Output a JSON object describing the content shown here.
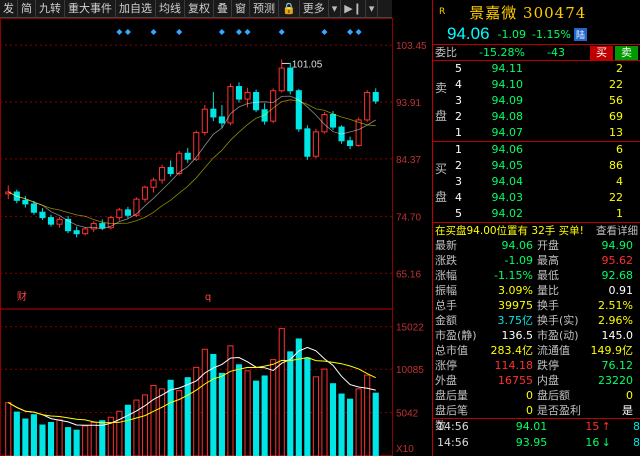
{
  "toolbar": {
    "items": [
      "发",
      "简",
      "九转",
      "重大事件",
      "加自选",
      "均线",
      "复权",
      "叠",
      "窗",
      "预测",
      "更多"
    ]
  },
  "chart": {
    "price_axis_labels": [
      "103.45",
      "93.91",
      "84.37",
      "74.70",
      "65.16"
    ],
    "volume_axis_labels": [
      "15022",
      "10085",
      "5042"
    ],
    "volume_unit": "X10",
    "high_marker": "101.05",
    "event_markers": [
      "财",
      "q"
    ],
    "colors": {
      "up": "#ff3030",
      "down": "#00e5e5",
      "ma5": "#ffffff",
      "ma10": "#ffff00",
      "grid": "#8b0000"
    }
  },
  "chart_data": {
    "type": "candlestick",
    "ylim": [
      60,
      107
    ],
    "candles": [
      [
        78.5,
        79.9,
        77.6,
        78.8
      ],
      [
        78.8,
        79.2,
        76.9,
        77.4
      ],
      [
        77.4,
        78.1,
        76.2,
        76.8
      ],
      [
        76.8,
        77.3,
        75.0,
        75.4
      ],
      [
        75.4,
        76.1,
        74.1,
        74.5
      ],
      [
        74.5,
        75.0,
        73.0,
        73.4
      ],
      [
        73.4,
        74.6,
        72.8,
        74.2
      ],
      [
        74.2,
        74.8,
        71.9,
        72.3
      ],
      [
        72.3,
        73.0,
        71.2,
        71.8
      ],
      [
        71.8,
        72.9,
        71.5,
        72.6
      ],
      [
        72.6,
        73.9,
        72.1,
        73.5
      ],
      [
        73.5,
        74.2,
        72.4,
        72.8
      ],
      [
        72.8,
        74.8,
        72.5,
        74.5
      ],
      [
        74.5,
        76.1,
        74.0,
        75.8
      ],
      [
        75.8,
        76.3,
        74.4,
        74.9
      ],
      [
        74.9,
        77.9,
        74.6,
        77.6
      ],
      [
        77.6,
        79.9,
        77.1,
        79.6
      ],
      [
        79.6,
        81.2,
        78.7,
        80.8
      ],
      [
        80.8,
        83.4,
        80.2,
        82.9
      ],
      [
        82.9,
        84.1,
        81.4,
        81.9
      ],
      [
        81.9,
        85.7,
        81.6,
        85.3
      ],
      [
        85.3,
        86.2,
        83.7,
        84.3
      ],
      [
        84.3,
        89.1,
        84.0,
        88.8
      ],
      [
        88.8,
        93.4,
        88.3,
        92.7
      ],
      [
        92.7,
        95.6,
        90.7,
        91.4
      ],
      [
        91.4,
        93.4,
        89.6,
        90.4
      ],
      [
        90.4,
        97.0,
        90.0,
        96.5
      ],
      [
        96.5,
        97.2,
        93.8,
        94.4
      ],
      [
        94.4,
        96.3,
        93.0,
        95.5
      ],
      [
        95.5,
        96.0,
        92.2,
        92.6
      ],
      [
        92.6,
        93.7,
        90.1,
        90.7
      ],
      [
        90.7,
        96.2,
        90.4,
        95.8
      ],
      [
        95.8,
        101.05,
        95.5,
        99.6
      ],
      [
        99.6,
        100.5,
        95.2,
        95.8
      ],
      [
        95.8,
        96.1,
        88.9,
        89.4
      ],
      [
        89.4,
        90.0,
        84.2,
        84.8
      ],
      [
        84.8,
        89.4,
        84.5,
        88.9
      ],
      [
        88.9,
        92.2,
        88.6,
        91.8
      ],
      [
        91.8,
        92.4,
        89.2,
        89.7
      ],
      [
        89.7,
        90.0,
        86.9,
        87.4
      ],
      [
        87.4,
        88.1,
        86.0,
        86.6
      ],
      [
        86.6,
        91.3,
        86.4,
        90.9
      ],
      [
        90.9,
        95.9,
        90.6,
        95.5
      ],
      [
        95.5,
        96.2,
        93.6,
        94.06
      ]
    ],
    "volume": [
      6200,
      5100,
      4300,
      4800,
      3600,
      3900,
      4200,
      3300,
      3000,
      3500,
      3900,
      4100,
      4500,
      5200,
      5900,
      6500,
      7100,
      8200,
      7800,
      8800,
      7600,
      9100,
      10300,
      12400,
      11800,
      9600,
      12800,
      10600,
      9900,
      8700,
      9300,
      11200,
      14800,
      12100,
      13600,
      11400,
      9200,
      10100,
      8400,
      7200,
      6600,
      7800,
      9400,
      7300
    ],
    "high_label": 101.05
  },
  "quote": {
    "marker": "R",
    "title": "景嘉微 300474",
    "price": "94.06",
    "change": "-1.09",
    "change_pct": "-1.15%",
    "badge": "陆"
  },
  "weibi": {
    "label": "委比",
    "pct": "-15.28%",
    "diff": "-43",
    "buy_btn": "买",
    "sell_btn": "卖"
  },
  "orderbook": {
    "sell_label": [
      "卖",
      "盘"
    ],
    "buy_label": [
      "买",
      "盘"
    ],
    "sells": [
      {
        "i": "5",
        "p": "94.11",
        "v": "2"
      },
      {
        "i": "4",
        "p": "94.10",
        "v": "22"
      },
      {
        "i": "3",
        "p": "94.09",
        "v": "56"
      },
      {
        "i": "2",
        "p": "94.08",
        "v": "69"
      },
      {
        "i": "1",
        "p": "94.07",
        "v": "13"
      }
    ],
    "buys": [
      {
        "i": "1",
        "p": "94.06",
        "v": "6"
      },
      {
        "i": "2",
        "p": "94.05",
        "v": "86"
      },
      {
        "i": "3",
        "p": "94.04",
        "v": "4"
      },
      {
        "i": "4",
        "p": "94.03",
        "v": "22"
      },
      {
        "i": "5",
        "p": "94.02",
        "v": "1"
      }
    ]
  },
  "notice": {
    "text": "在买盘94.00位置有 32手 买单!",
    "link": "查看详细"
  },
  "stats": [
    {
      "k1": "最新",
      "v1": "94.06",
      "c1": "down",
      "k2": "开盘",
      "v2": "94.90",
      "c2": "down"
    },
    {
      "k1": "涨跌",
      "v1": "-1.09",
      "c1": "down",
      "k2": "最高",
      "v2": "95.62",
      "c2": "up"
    },
    {
      "k1": "涨幅",
      "v1": "-1.15%",
      "c1": "down",
      "k2": "最低",
      "v2": "92.68",
      "c2": "down"
    },
    {
      "k1": "振幅",
      "v1": "3.09%",
      "c1": "yellow",
      "k2": "量比",
      "v2": "0.91",
      "c2": "white"
    },
    {
      "k1": "总手",
      "v1": "39975",
      "c1": "yellow",
      "k2": "换手",
      "v2": "2.51%",
      "c2": "yellow"
    },
    {
      "k1": "金额",
      "v1": "3.75亿",
      "c1": "cyan",
      "k2": "换手(实)",
      "v2": "2.96%",
      "c2": "yellow"
    },
    {
      "k1": "市盈(静)",
      "v1": "136.5",
      "c1": "white",
      "k2": "市盈(动)",
      "v2": "145.0",
      "c2": "white"
    },
    {
      "k1": "总市值",
      "v1": "283.4亿",
      "c1": "yellow",
      "k2": "流通值",
      "v2": "149.9亿",
      "c2": "yellow"
    },
    {
      "k1": "涨停",
      "v1": "114.18",
      "c1": "up",
      "k2": "跌停",
      "v2": "76.12",
      "c2": "down"
    },
    {
      "k1": "外盘",
      "v1": "16755",
      "c1": "up",
      "k2": "内盘",
      "v2": "23220",
      "c2": "down"
    },
    {
      "k1": "盘后量",
      "v1": "0",
      "c1": "yellow",
      "k2": "盘后额",
      "v2": "0",
      "c2": "yellow"
    },
    {
      "k1": "盘后笔数",
      "v1": "0",
      "c1": "yellow",
      "k2": "是否盈利",
      "v2": "是",
      "c2": "white"
    }
  ],
  "ticks": [
    {
      "t": "14:56",
      "p": "94.01",
      "v": "15",
      "dir": "up",
      "n": "8"
    },
    {
      "t": "14:56",
      "p": "93.95",
      "v": "16",
      "dir": "down",
      "n": "8"
    }
  ]
}
